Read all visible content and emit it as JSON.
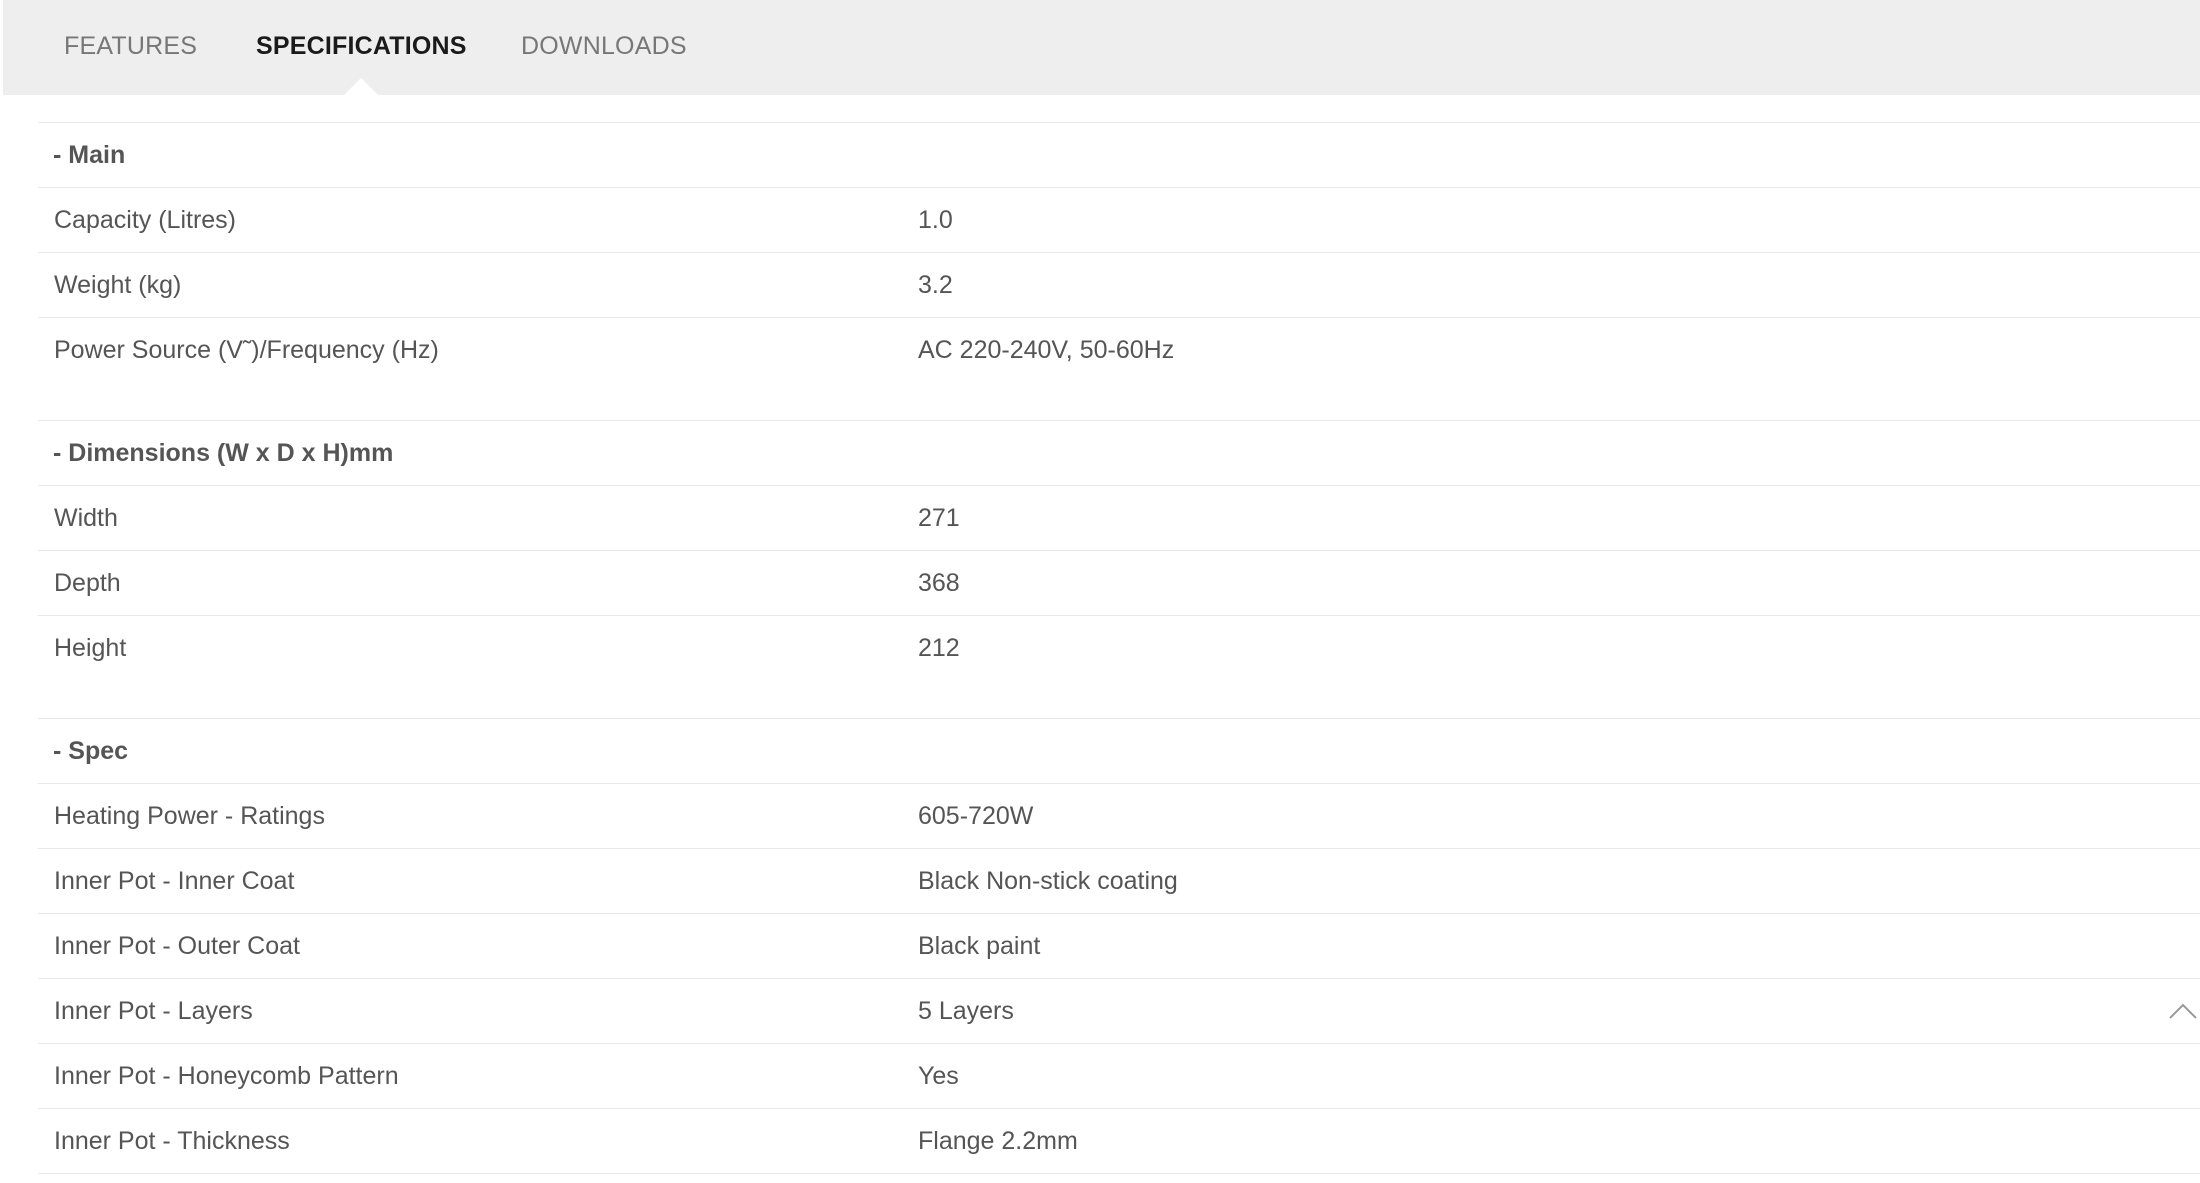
{
  "tabs": [
    {
      "label": "FEATURES",
      "active": false
    },
    {
      "label": "SPECIFICATIONS",
      "active": true
    },
    {
      "label": "DOWNLOADS",
      "active": false
    }
  ],
  "sections": [
    {
      "title": "- Main",
      "rows": [
        {
          "label": "Capacity (Litres)",
          "value": "1.0"
        },
        {
          "label": "Weight (kg)",
          "value": "3.2"
        },
        {
          "label": "Power Source (V˜)/Frequency (Hz)",
          "value": "AC 220-240V, 50-60Hz"
        }
      ]
    },
    {
      "title": "- Dimensions (W x D x H)mm",
      "rows": [
        {
          "label": "Width",
          "value": "271"
        },
        {
          "label": "Depth",
          "value": "368"
        },
        {
          "label": "Height",
          "value": "212"
        }
      ]
    },
    {
      "title": "- Spec",
      "rows": [
        {
          "label": "Heating Power - Ratings",
          "value": "605-720W"
        },
        {
          "label": "Inner Pot - Inner Coat",
          "value": "Black Non-stick coating"
        },
        {
          "label": "Inner Pot - Outer Coat",
          "value": "Black paint"
        },
        {
          "label": "Inner Pot - Layers",
          "value": "5 Layers"
        },
        {
          "label": "Inner Pot - Honeycomb Pattern",
          "value": "Yes"
        },
        {
          "label": "Inner Pot - Thickness",
          "value": "Flange 2.2mm"
        }
      ]
    }
  ],
  "icons": {
    "scroll_top": "chevron-up-icon"
  },
  "colors": {
    "tabbar_bg": "#eeeeee",
    "tab_inactive": "#777777",
    "tab_active": "#1a1a1a",
    "text": "#555555",
    "divider": "#e8e8e8"
  }
}
